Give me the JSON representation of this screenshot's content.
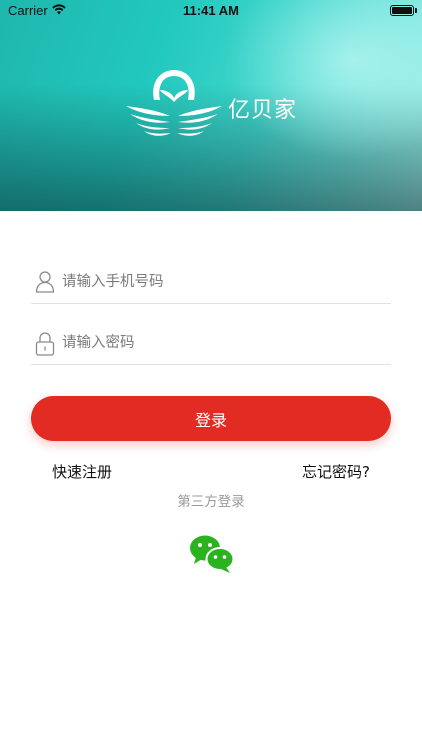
{
  "status_bar": {
    "carrier": "Carrier",
    "time": "11:41 AM",
    "wifi_icon": "wifi-icon",
    "battery_icon": "battery-icon"
  },
  "header": {
    "brand_name": "亿贝家",
    "logo_icon": "swan-logo-icon",
    "colors": {
      "teal": "#1fb7ae",
      "mint": "#9ff0ea"
    }
  },
  "form": {
    "username": {
      "placeholder": "请输入手机号码",
      "value": "",
      "icon": "user-icon"
    },
    "password": {
      "placeholder": "请输入密码",
      "value": "",
      "icon": "lock-icon"
    },
    "login_label": "登录",
    "login_color": "#e22b22"
  },
  "links": {
    "register": "快速注册",
    "forgot": "忘记密码?"
  },
  "third_party": {
    "label": "第三方登录",
    "wechat_icon": "wechat-icon",
    "wechat_color": "#2bb31f"
  }
}
